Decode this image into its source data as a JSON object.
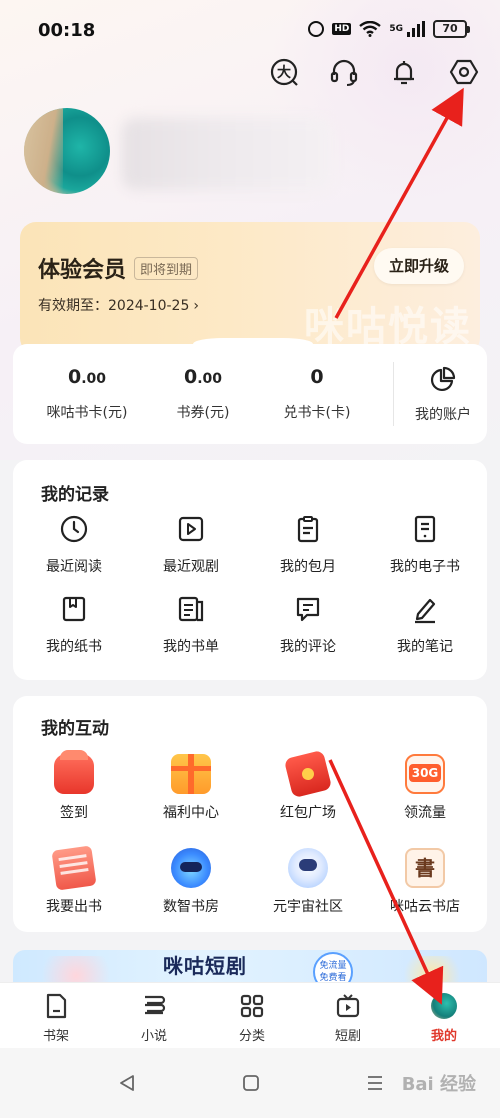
{
  "status_bar": {
    "time": "00:18",
    "network": "5G",
    "battery": "70"
  },
  "header_actions": [
    {
      "name": "font-size-icon",
      "glyph": "大"
    },
    {
      "name": "headset-icon"
    },
    {
      "name": "bell-icon"
    },
    {
      "name": "settings-hex-icon"
    }
  ],
  "vip": {
    "title": "体验会员",
    "badge": "即将到期",
    "expire_text": "有效期至：2024-10-25",
    "chevron": "›",
    "upgrade_label": "立即升级",
    "watermark": "咪咕悦读"
  },
  "wallet": {
    "items": [
      {
        "int": "0",
        "dec": ".00",
        "label": "咪咕书卡(元)"
      },
      {
        "int": "0",
        "dec": ".00",
        "label": "书券(元)"
      },
      {
        "int": "0",
        "dec": "",
        "label": "兑书卡(卡)"
      }
    ],
    "account_label": "我的账户",
    "account_icon": "pie-chart-icon"
  },
  "records": {
    "title": "我的记录",
    "items": [
      {
        "label": "最近阅读",
        "icon": "clock-icon"
      },
      {
        "label": "最近观剧",
        "icon": "play-icon"
      },
      {
        "label": "我的包月",
        "icon": "clipboard-icon"
      },
      {
        "label": "我的电子书",
        "icon": "ebook-icon"
      },
      {
        "label": "我的纸书",
        "icon": "bookmark-book-icon"
      },
      {
        "label": "我的书单",
        "icon": "booklist-icon"
      },
      {
        "label": "我的评论",
        "icon": "comment-icon"
      },
      {
        "label": "我的笔记",
        "icon": "pen-icon"
      }
    ]
  },
  "interactions": {
    "title": "我的互动",
    "items": [
      {
        "label": "签到",
        "icon": "sign-in-icon"
      },
      {
        "label": "福利中心",
        "icon": "gift-box-icon"
      },
      {
        "label": "红包广场",
        "icon": "red-envelope-icon"
      },
      {
        "label": "领流量",
        "icon": "data-30g-icon",
        "badge": "30G"
      },
      {
        "label": "我要出书",
        "icon": "publish-book-icon"
      },
      {
        "label": "数智书房",
        "icon": "robot-icon"
      },
      {
        "label": "元宇宙社区",
        "icon": "astronaut-icon"
      },
      {
        "label": "咪咕云书店",
        "icon": "cloud-bookstore-icon",
        "glyph": "書"
      }
    ]
  },
  "banner": {
    "text": "咪咕短剧",
    "badge": "免流量 免费看"
  },
  "tabs": [
    {
      "label": "书架",
      "icon": "bookshelf-icon",
      "active": false
    },
    {
      "label": "小说",
      "icon": "novel-icon",
      "active": false
    },
    {
      "label": "分类",
      "icon": "category-icon",
      "active": false
    },
    {
      "label": "短剧",
      "icon": "short-drama-icon",
      "active": false
    },
    {
      "label": "我的",
      "icon": "avatar",
      "active": true
    }
  ],
  "watermark": "Bai 经验",
  "colors": {
    "accent": "#e0392c",
    "annotation_arrow": "#e8211c",
    "vip_gold": "#fbe4b8"
  }
}
